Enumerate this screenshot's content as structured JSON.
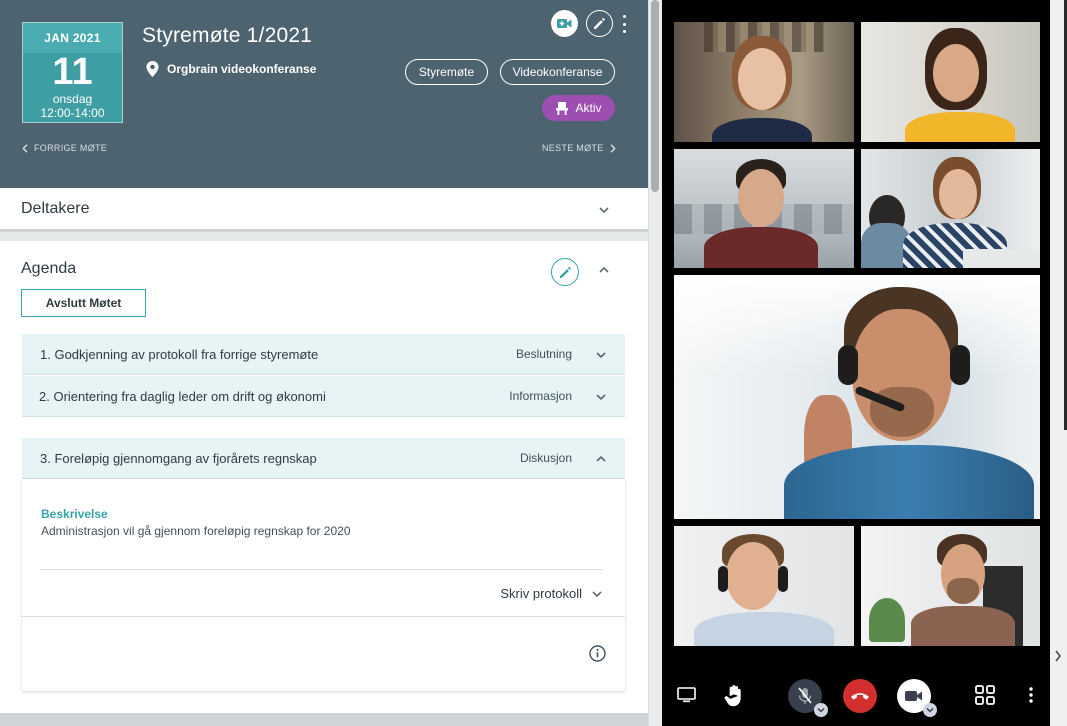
{
  "header": {
    "date": {
      "month": "JAN 2021",
      "day": "11",
      "weekday": "onsdag",
      "time": "12:00-14:00"
    },
    "title": "Styremøte 1/2021",
    "location": "Orgbrain videokonferanse",
    "tags": [
      "Styremøte",
      "Videokonferanse"
    ],
    "status": "Aktiv",
    "prev_label": "FORRIGE MØTE",
    "next_label": "NESTE MØTE",
    "icons": [
      "video-icon",
      "edit-icon",
      "kebab-icon"
    ]
  },
  "participants": {
    "title": "Deltakere"
  },
  "agenda": {
    "title": "Agenda",
    "end_button": "Avslutt Møtet",
    "items": [
      {
        "label": "1. Godkjenning av protokoll fra forrige styremøte",
        "type": "Beslutning",
        "expanded": false
      },
      {
        "label": "2. Orientering fra daglig leder om drift og økonomi",
        "type": "Informasjon",
        "expanded": false
      },
      {
        "label": "3. Foreløpig gjennomgang av fjorårets regnskap",
        "type": "Diskusjon",
        "expanded": true
      }
    ],
    "expanded_item": {
      "description_label": "Beskrivelse",
      "description": "Administrasjon vil gå gjennom foreløpig regnskap for 2020",
      "protocol_label": "Skriv protokoll"
    }
  },
  "video": {
    "participants": [
      "participant-1",
      "participant-2",
      "participant-3",
      "participant-4",
      "active-speaker",
      "participant-5",
      "participant-6"
    ],
    "toolbar": [
      "screen-share-icon",
      "raise-hand-icon",
      "mic-muted-icon",
      "hang-up-icon",
      "camera-icon",
      "grid-view-icon",
      "more-icon"
    ],
    "colors": {
      "hangup": "#d32f2f",
      "status_active": "#9c4fb0",
      "accent": "#3aa3a8",
      "header_bg": "#4d6370"
    }
  }
}
